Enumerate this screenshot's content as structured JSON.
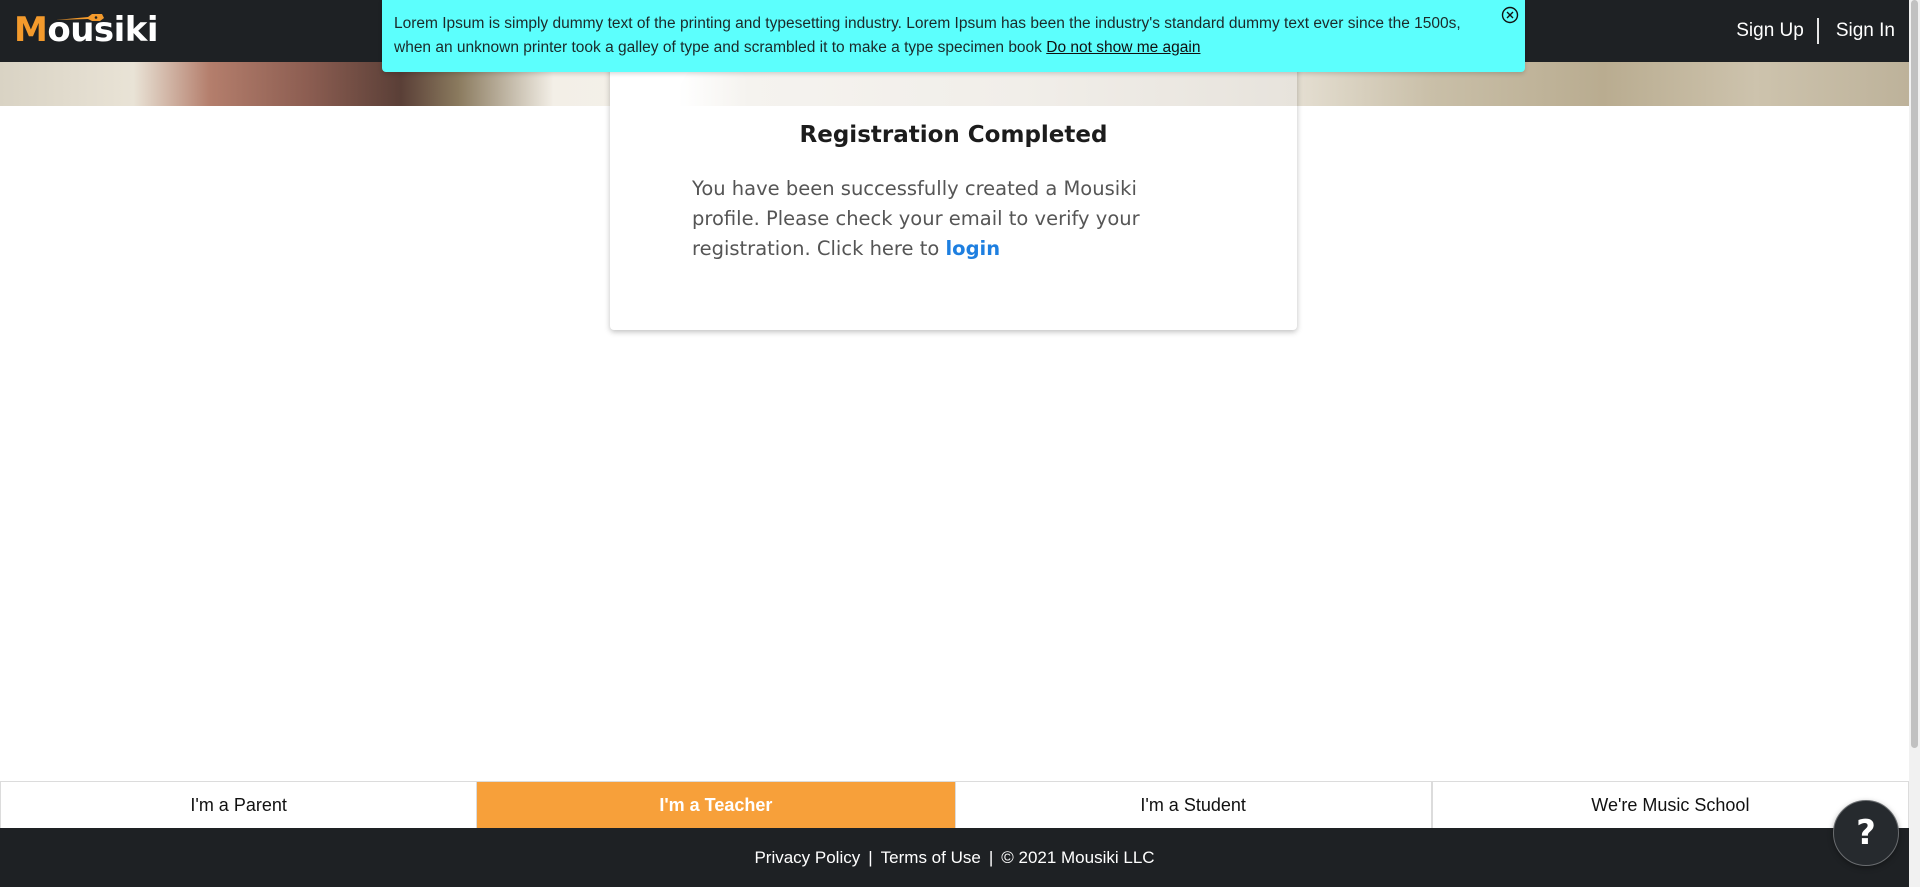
{
  "header": {
    "logo_m": "M",
    "logo_rest": "ousiki",
    "sign_up": "Sign Up",
    "sign_in": "Sign In"
  },
  "banner": {
    "message": "Lorem Ipsum is simply dummy text of the printing and typesetting industry. Lorem Ipsum has been the industry's standard dummy text ever since the 1500s, when an unknown printer took a galley of type and scrambled it to make a type specimen book",
    "dismiss_link": "Do not show me again",
    "close_icon": "close-circle-icon",
    "background": "#5cfffd"
  },
  "card": {
    "title": "Registration Completed",
    "body_text": "You have been successfully created a Mousiki profile. Please check your email to verify your registration. Click here to",
    "login_link": "login"
  },
  "roles": {
    "tabs": [
      {
        "label": "I'm a Parent"
      },
      {
        "label": "I'm a Teacher"
      },
      {
        "label": "I'm a Student"
      },
      {
        "label": "We're Music School"
      }
    ],
    "active_label": "I'm a Teacher",
    "active_color": "#f7a03a"
  },
  "footer": {
    "privacy": "Privacy Policy",
    "sep": "|",
    "terms": "Terms of Use",
    "copyright": "© 2021 Mousiki LLC"
  },
  "help": {
    "label": "?",
    "icon": "help-icon"
  },
  "colors": {
    "nav_bg": "#1e2124",
    "accent": "#f39a2c",
    "link": "#1e7fe0"
  }
}
